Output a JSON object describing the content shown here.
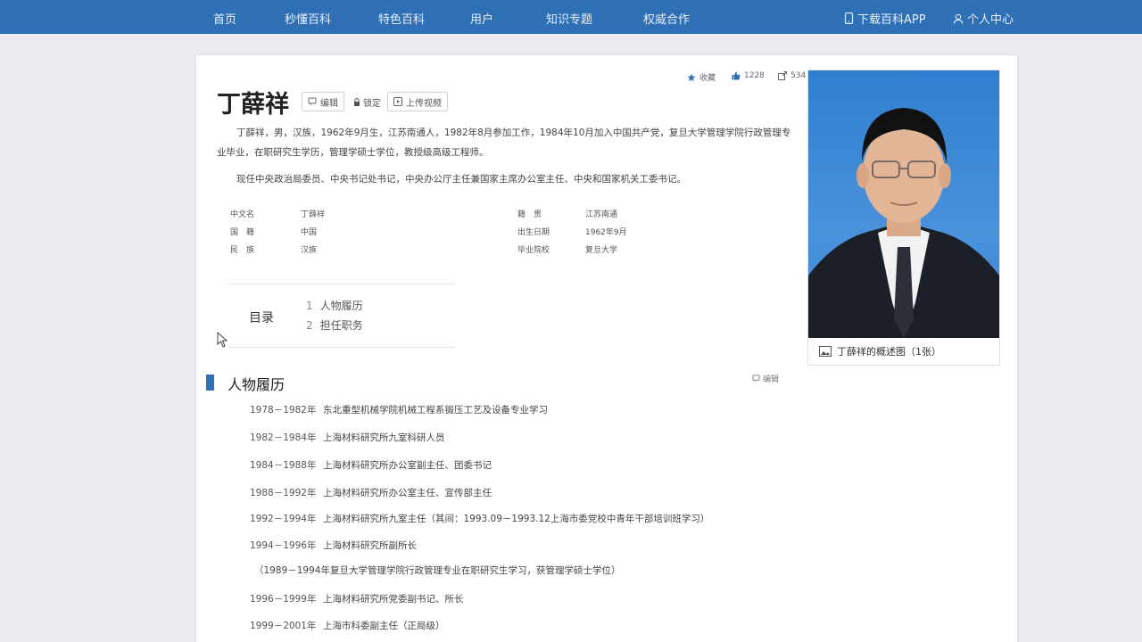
{
  "nav": {
    "items": [
      "首页",
      "秒懂百科",
      "特色百科",
      "用户",
      "知识专题",
      "权威合作"
    ],
    "download": "下载百科APP",
    "personal": "个人中心"
  },
  "entry": {
    "title": "丁薛祥",
    "btn_edit": "编辑",
    "lock_label": "锁定",
    "btn_upload": "上传视频",
    "collect": "收藏",
    "likes": "1228",
    "shares": "534"
  },
  "intro": {
    "p1": "丁薛祥，男，汉族，1962年9月生，江苏南通人，1982年8月参加工作，1984年10月加入中国共产党，复旦大学管理学院行政管理专业毕业，在职研究生学历，管理学硕士学位，教授级高级工程师。",
    "p2": "现任中央政治局委员、中央书记处书记，中央办公厅主任兼国家主席办公室主任、中央和国家机关工委书记。"
  },
  "basic_info": {
    "left": [
      {
        "label": "中文名",
        "value": "丁薛祥"
      },
      {
        "label": "国　籍",
        "value": "中国"
      },
      {
        "label": "民　族",
        "value": "汉族"
      }
    ],
    "right": [
      {
        "label": "籍　贯",
        "value": "江苏南通"
      },
      {
        "label": "出生日期",
        "value": "1962年9月"
      },
      {
        "label": "毕业院校",
        "value": "复旦大学"
      }
    ]
  },
  "toc": {
    "title": "目录",
    "items": [
      {
        "num": "1",
        "label": "人物履历"
      },
      {
        "num": "2",
        "label": "担任职务"
      }
    ]
  },
  "section": {
    "title": "人物履历",
    "edit": "编辑"
  },
  "timeline": [
    {
      "years": "1978－1982年",
      "text": "东北重型机械学院机械工程系锻压工艺及设备专业学习"
    },
    {
      "years": "1982－1984年",
      "text": "上海材料研究所九室科研人员"
    },
    {
      "years": "1984－1988年",
      "text": "上海材料研究所办公室副主任、团委书记"
    },
    {
      "years": "1988－1992年",
      "text": "上海材料研究所办公室主任、宣传部主任"
    },
    {
      "years": "1992－1994年",
      "text": "上海材料研究所九室主任（其间：1993.09－1993.12上海市委党校中青年干部培训班学习）"
    },
    {
      "years": "1994－1996年",
      "text": "上海材料研究所副所长"
    },
    {
      "years": "",
      "text": "（1989－1994年复旦大学管理学院行政管理专业在职研究生学习，获管理学硕士学位）"
    },
    {
      "years": "1996－1999年",
      "text": "上海材料研究所党委副书记、所长"
    },
    {
      "years": "1999－2001年",
      "text": "上海市科委副主任（正局级）"
    }
  ],
  "photo": {
    "caption": "丁薛祥的概述图（1张）"
  }
}
